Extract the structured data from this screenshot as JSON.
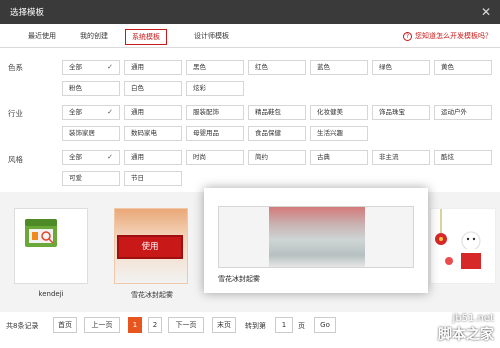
{
  "window": {
    "title": "选择模板",
    "close_glyph": "✕"
  },
  "tabs": [
    "最近使用",
    "我的创建",
    "系统模板",
    "设计师模板"
  ],
  "hint": {
    "icon": "?",
    "text": "您知道怎么开发模板吗？"
  },
  "filters": {
    "color": {
      "label": "色系",
      "row1": [
        "全部",
        "通用",
        "黑色",
        "红色",
        "蓝色",
        "绿色",
        "黄色"
      ],
      "row2": [
        "粉色",
        "白色",
        "炫彩"
      ]
    },
    "industry": {
      "label": "行业",
      "row1": [
        "全部",
        "通用",
        "服装配饰",
        "精品鞋包",
        "化妆健美",
        "饰品珠宝",
        "运动户外"
      ],
      "row2": [
        "装饰家居",
        "数码家电",
        "母婴用品",
        "食品保健",
        "生活兴趣"
      ]
    },
    "style": {
      "label": "风格",
      "row1": [
        "全部",
        "通用",
        "时尚",
        "简约",
        "古典",
        "非主流",
        "酷炫"
      ],
      "row2": [
        "可爱",
        "节日"
      ]
    },
    "check_glyph": "✓"
  },
  "templates": [
    {
      "name": "kendeji"
    },
    {
      "name": "雪花冰封起雾",
      "use_label": "使用"
    }
  ],
  "popup": {
    "title": "雪花冰封起雾"
  },
  "pager": {
    "total": "共8条记录",
    "first": "首页",
    "prev": "上一页",
    "p1": "1",
    "p2": "2",
    "next": "下一页",
    "last": "末页",
    "goto": "转到第",
    "page_value": "1",
    "unit": "页",
    "go": "Go"
  },
  "watermark": {
    "site": "jb51.net",
    "name": "脚本之家"
  }
}
